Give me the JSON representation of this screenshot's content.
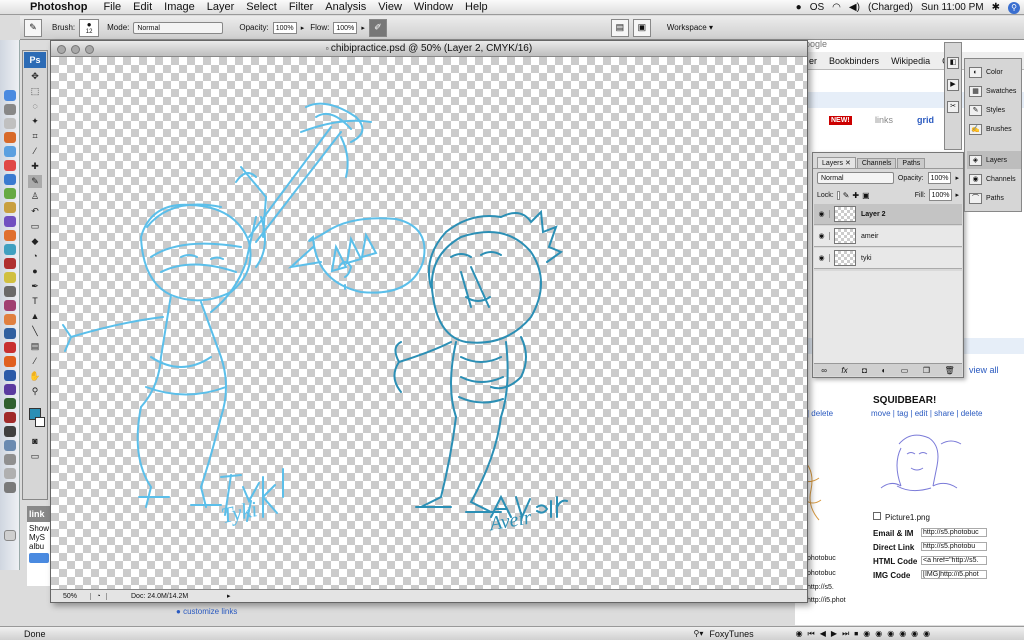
{
  "menubar": {
    "app": "Photoshop",
    "items": [
      "File",
      "Edit",
      "Image",
      "Layer",
      "Select",
      "Filter",
      "Analysis",
      "View",
      "Window",
      "Help"
    ],
    "status": {
      "os_label": "OS",
      "battery": "(Charged)",
      "clock": "Sun 11:00 PM"
    }
  },
  "options_bar": {
    "brush_label": "Brush:",
    "brush_size": "12",
    "mode_label": "Mode:",
    "mode_value": "Normal",
    "opacity_label": "Opacity:",
    "opacity_value": "100%",
    "flow_label": "Flow:",
    "flow_value": "100%",
    "workspace_label": "Workspace ▾"
  },
  "tools_panel": {
    "logo": "Ps"
  },
  "document": {
    "title": "chibipractice.psd @ 50% (Layer 2, CMYK/16)",
    "zoom": "50%",
    "doc_size": "Doc: 24.0M/14.2M",
    "annotations": {
      "left_name": "Tyki",
      "right_name": "Aveir"
    }
  },
  "layers_panel": {
    "tabs": [
      "Layers",
      "Channels",
      "Paths"
    ],
    "blend_mode": "Normal",
    "opacity_label": "Opacity:",
    "opacity_value": "100%",
    "lock_label": "Lock:",
    "fill_label": "Fill:",
    "fill_value": "100%",
    "layers": [
      {
        "name": "Layer 2",
        "selected": true
      },
      {
        "name": "ameir",
        "selected": false
      },
      {
        "name": "tyki",
        "selected": false
      }
    ]
  },
  "right_dock": {
    "group1": [
      "Color",
      "Swatches",
      "Styles",
      "Brushes"
    ],
    "group2": [
      "Layers",
      "Channels",
      "Paths"
    ]
  },
  "browser": {
    "search_hint": "oogle",
    "bookmarks": [
      "er",
      "Bookbinders",
      "Wikipedia",
      "G"
    ],
    "new_badge": "NEW!",
    "links": "links",
    "grid": "grid",
    "delete1": "| delete",
    "view_all": "view all",
    "album_title": "SQUIDBEAR!",
    "actions": "move | tag | edit | share | delete",
    "filename": "Picture1.png",
    "codes": [
      {
        "label": "Email & IM",
        "value": "http://s5.photobuc"
      },
      {
        "label": "Direct Link",
        "value": "http://s5.photobu"
      },
      {
        "label": "HTML Code",
        "value": "<a href=\"http://s5."
      },
      {
        "label": "IMG Code",
        "value": "[IMG]http://i5.phot"
      }
    ],
    "side_snippets": [
      "photobuc",
      "photobuc",
      "http://s5.",
      "http://i5.phot"
    ],
    "customize": "customize links",
    "left_partial": {
      "link": "link",
      "show": "Show",
      "mys": "MyS",
      "albu": "albu"
    }
  },
  "status_bar": {
    "left": "Done",
    "foxytunes": "FoxyTunes"
  },
  "colors": {
    "sketch_light": "#5bbfea",
    "sketch_dark": "#2b8fb5",
    "ps_blue": "#2c6bb5"
  }
}
